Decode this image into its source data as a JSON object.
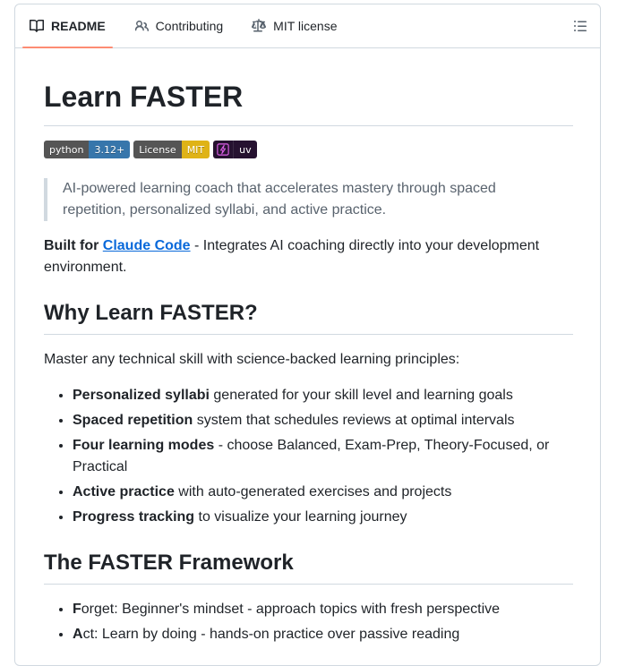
{
  "tabs": [
    {
      "label": "README",
      "icon": "book-icon",
      "active": true
    },
    {
      "label": "Contributing",
      "icon": "people-icon",
      "active": false
    },
    {
      "label": "MIT license",
      "icon": "law-icon",
      "active": false
    }
  ],
  "badges": {
    "python": {
      "left": "python",
      "right": "3.12+"
    },
    "license": {
      "left": "License",
      "right": "MIT"
    },
    "uv": {
      "right": "uv"
    }
  },
  "readme": {
    "title": "Learn FASTER",
    "quote": "AI-powered learning coach that accelerates mastery through spaced repetition, personalized syllabi, and active practice.",
    "built_for": {
      "bold": "Built for",
      "link": "Claude Code",
      "rest": " - Integrates AI coaching directly into your development environment."
    },
    "why_heading": "Why Learn FASTER?",
    "why_intro": "Master any technical skill with science-backed learning principles:",
    "features": [
      {
        "bold": "Personalized syllabi",
        "text": " generated for your skill level and learning goals"
      },
      {
        "bold": "Spaced repetition",
        "text": " system that schedules reviews at optimal intervals"
      },
      {
        "bold": "Four learning modes",
        "text": " - choose Balanced, Exam-Prep, Theory-Focused, or Practical"
      },
      {
        "bold": "Active practice",
        "text": " with auto-generated exercises and projects"
      },
      {
        "bold": "Progress tracking",
        "text": " to visualize your learning journey"
      }
    ],
    "framework_heading": "The FASTER Framework",
    "framework": [
      {
        "bold": "F",
        "text": "orget: Beginner's mindset - approach topics with fresh perspective"
      },
      {
        "bold": "A",
        "text": "ct: Learn by doing - hands-on practice over passive reading"
      }
    ]
  },
  "colors": {
    "accent_underline": "#fd8c73",
    "link": "#0969da"
  }
}
